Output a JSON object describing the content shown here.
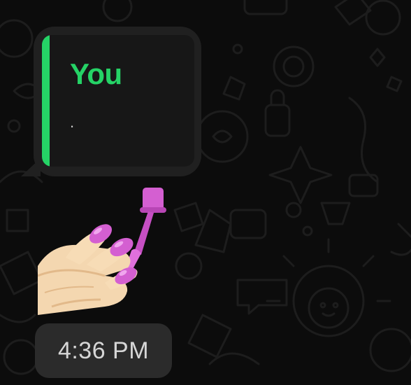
{
  "chat": {
    "quoted_message": {
      "author": "You",
      "text": "."
    },
    "sticker": {
      "name": "nail-polish-emoji",
      "colors": {
        "polish": "#d45fd1",
        "skin": "#f4d7b0"
      }
    },
    "timestamp": "4:36 PM"
  },
  "colors": {
    "background": "#0c0c0c",
    "bubble": "#202020",
    "quote_background": "#171717",
    "accent": "#25d366",
    "time_pill": "#2b2b2b"
  }
}
